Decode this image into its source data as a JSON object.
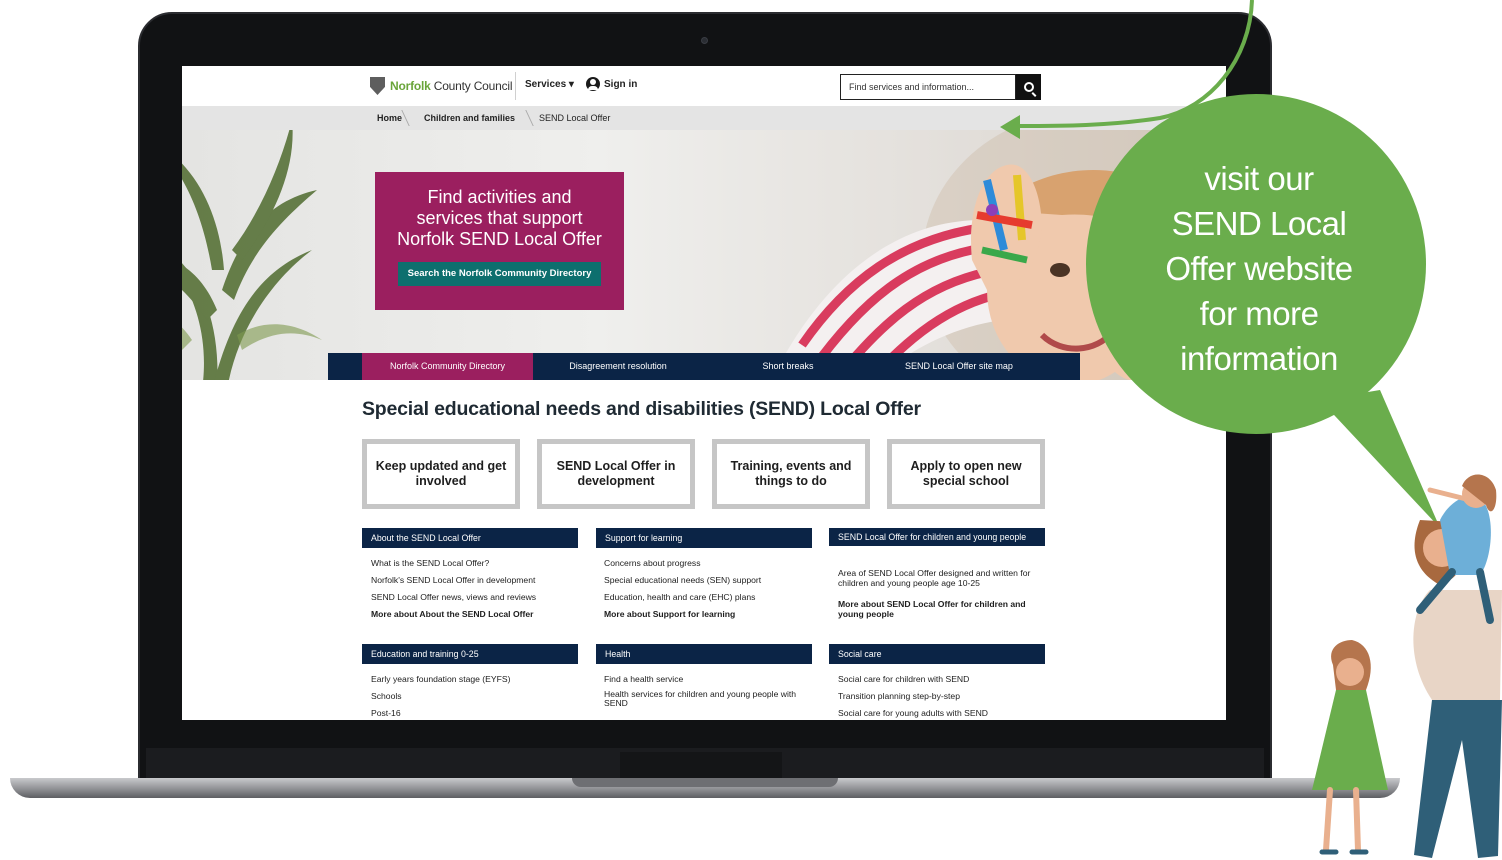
{
  "site": {
    "logo_brand": "Norfolk",
    "logo_rest": " County Council",
    "services_label": "Services ▾",
    "signin_label": "Sign in",
    "search_placeholder": "Find services and information..."
  },
  "breadcrumb": [
    "Home",
    "Children and families",
    "SEND Local Offer"
  ],
  "hero": {
    "title_lines": [
      "Find activities and",
      "services that support",
      "Norfolk SEND Local Offer"
    ],
    "button_label": "Search the Norfolk Community Directory"
  },
  "nav_tabs": [
    "Norfolk Community Directory",
    "Disagreement resolution",
    "Short breaks",
    "SEND Local Offer site map"
  ],
  "page_title": "Special educational needs and disabilities (SEND) Local Offer",
  "tiles": [
    "Keep updated and get involved",
    "SEND Local Offer in development",
    "Training, events and things to do",
    "Apply to open new special school"
  ],
  "sections": [
    {
      "heading": "About the SEND Local Offer",
      "links": [
        "What is the SEND Local Offer?",
        "Norfolk's SEND Local Offer in development",
        "SEND Local Offer news, views and reviews"
      ],
      "more": "More about About the SEND Local Offer"
    },
    {
      "heading": "Support for learning",
      "links": [
        "Concerns about progress",
        "Special educational needs (SEN) support",
        "Education, health and care (EHC) plans"
      ],
      "more": "More about Support for learning"
    },
    {
      "heading": "SEND Local Offer for children and young people",
      "links": [
        "Area of SEND Local Offer designed and written for children and young people age 10-25"
      ],
      "more": "More about SEND Local Offer for children and young people"
    },
    {
      "heading": "Education and training 0-25",
      "links": [
        "Early years foundation stage (EYFS)",
        "Schools",
        "Post-16"
      ]
    },
    {
      "heading": "Health",
      "links": [
        "Find a health service",
        "Health services for children and young people with SEND"
      ]
    },
    {
      "heading": "Social care",
      "links": [
        "Social care for children with SEND",
        "Transition planning step-by-step",
        "Social care for young adults with SEND"
      ]
    }
  ],
  "callout": {
    "lines": [
      "visit our",
      "SEND Local",
      "Offer website",
      "for more",
      "information"
    ],
    "color": "#6aad4c"
  }
}
